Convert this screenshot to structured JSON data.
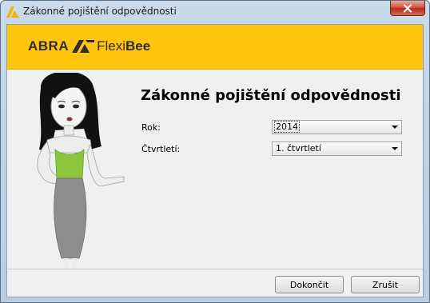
{
  "window": {
    "title": "Zákonné pojištění odpovědnosti",
    "close_icon": "close-icon"
  },
  "banner": {
    "brand_left": "ABRA",
    "brand_flexi": "Flexi",
    "brand_bee": "Bee",
    "background_color": "#ffc40e"
  },
  "form": {
    "heading": "Zákonné pojištění odpovědnosti",
    "year_label": "Rok:",
    "year_value": "2014",
    "quarter_label": "Čtvrtletí:",
    "quarter_value": "1. čtvrtletí"
  },
  "buttons": {
    "finish_label": "Dokončit",
    "cancel_label": "Zrušit"
  }
}
